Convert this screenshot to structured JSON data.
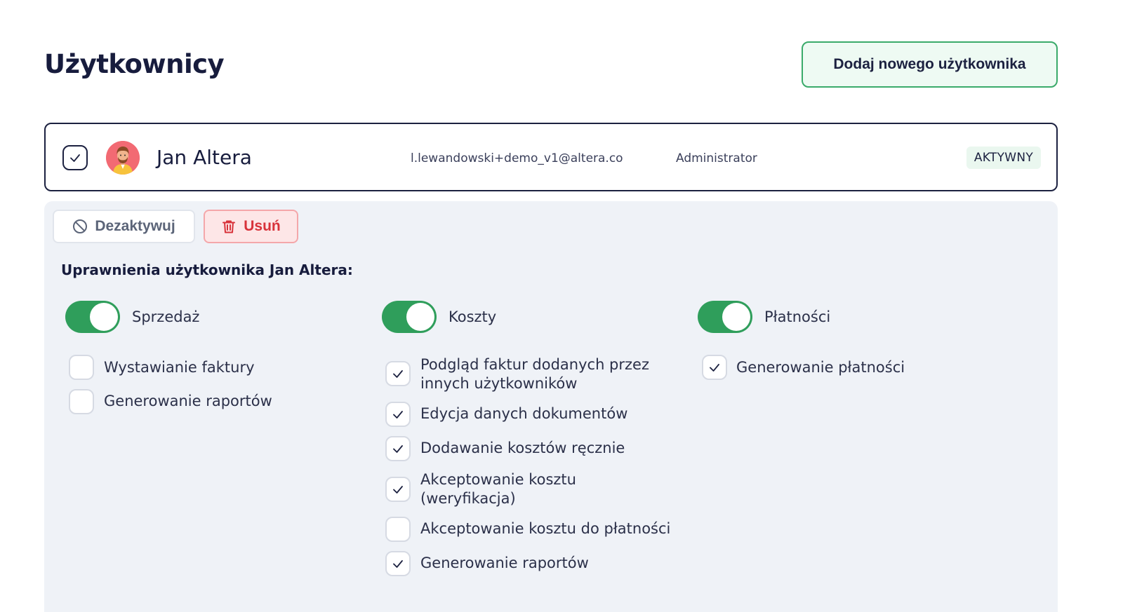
{
  "page": {
    "title": "Użytkownicy",
    "add_button": "Dodaj nowego użytkownika"
  },
  "user": {
    "name": "Jan Altera",
    "email": "l.lewandowski+demo_v1@altera.co",
    "role": "Administrator",
    "status": "AKTYWNY",
    "selected": true
  },
  "actions": {
    "deactivate": "Dezaktywuj",
    "delete": "Usuń"
  },
  "permissions": {
    "heading": "Uprawnienia użytkownika Jan Altera:",
    "groups": [
      {
        "label": "Sprzedaż",
        "enabled": true,
        "items": [
          {
            "label": "Wystawianie faktury",
            "checked": false
          },
          {
            "label": "Generowanie raportów",
            "checked": false
          }
        ]
      },
      {
        "label": "Koszty",
        "enabled": true,
        "items": [
          {
            "label_line1": "Podgląd faktur dodanych przez",
            "label_line2": "innych użytkowników",
            "checked": true
          },
          {
            "label": "Edycja danych dokumentów",
            "checked": true
          },
          {
            "label": "Dodawanie kosztów ręcznie",
            "checked": true
          },
          {
            "label_line1": "Akceptowanie kosztu",
            "label_line2": "(weryfikacja)",
            "checked": true
          },
          {
            "label": "Akceptowanie kosztu do płatności",
            "checked": false
          },
          {
            "label": "Generowanie raportów",
            "checked": true
          }
        ]
      },
      {
        "label": "Płatności",
        "enabled": true,
        "items": [
          {
            "label": "Generowanie płatności",
            "checked": true
          }
        ]
      }
    ]
  },
  "colors": {
    "accent_green": "#2f9e5b",
    "danger_red": "#d8323a",
    "text_dark": "#171c3d",
    "panel_bg": "#eff2f7"
  }
}
